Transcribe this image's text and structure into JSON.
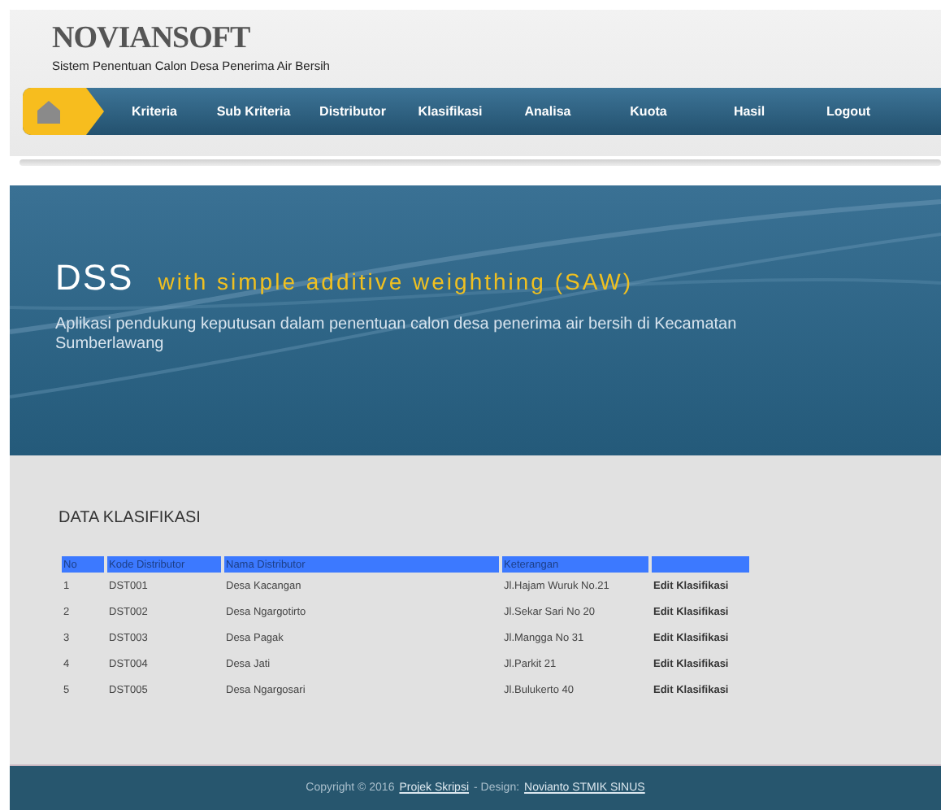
{
  "header": {
    "logo": "NOVIANSOFT",
    "subtitle": "Sistem Penentuan Calon Desa Penerima Air Bersih"
  },
  "nav": {
    "items": [
      {
        "label": "Kriteria"
      },
      {
        "label": "Sub Kriteria"
      },
      {
        "label": "Distributor"
      },
      {
        "label": "Klasifikasi"
      },
      {
        "label": "Analisa"
      },
      {
        "label": "Kuota"
      },
      {
        "label": "Hasil"
      },
      {
        "label": "Logout"
      }
    ]
  },
  "banner": {
    "title": "DSS",
    "tagline": "with simple additive weighthing (SAW)",
    "description": "Aplikasi pendukung keputusan dalam penentuan calon desa penerima air bersih di Kecamatan Sumberlawang"
  },
  "section_title": "DATA KLASIFIKASI",
  "table": {
    "columns": [
      "No",
      "Kode Distributor",
      "Nama Distributor",
      "Keterangan"
    ],
    "rows": [
      {
        "no": "1",
        "code": "DST001",
        "name": "Desa Kacangan",
        "note": "Jl.Hajam Wuruk No.21",
        "action": "Edit Klasifikasi"
      },
      {
        "no": "2",
        "code": "DST002",
        "name": "Desa Ngargotirto",
        "note": "Jl.Sekar Sari No 20",
        "action": "Edit Klasifikasi"
      },
      {
        "no": "3",
        "code": "DST003",
        "name": "Desa Pagak",
        "note": "Jl.Mangga No 31",
        "action": "Edit Klasifikasi"
      },
      {
        "no": "4",
        "code": "DST004",
        "name": "Desa Jati",
        "note": "Jl.Parkit 21",
        "action": "Edit Klasifikasi"
      },
      {
        "no": "5",
        "code": "DST005",
        "name": "Desa Ngargosari",
        "note": "Jl.Bulukerto 40",
        "action": "Edit Klasifikasi"
      }
    ]
  },
  "footer": {
    "copyright": "Copyright © 2016",
    "link1": "Projek Skripsi",
    "separator": "- Design:",
    "link2": "Novianto STMIK SINUS"
  }
}
